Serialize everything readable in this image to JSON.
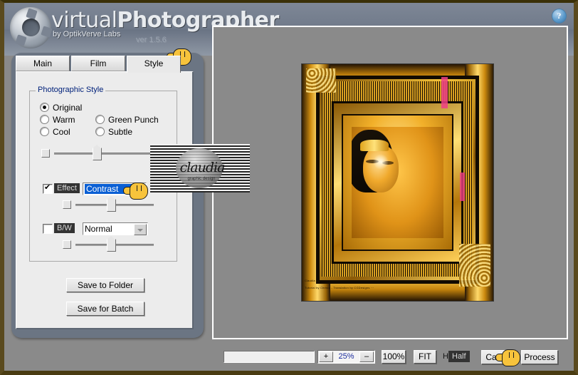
{
  "app": {
    "brand_prefix": "virtual",
    "brand_suffix": "Photographer",
    "brand_sub": "by OptikVerve Labs",
    "version": "ver 1.5.6",
    "help_icon": "question-mark-icon"
  },
  "tabs": [
    {
      "label": "Main",
      "active": false
    },
    {
      "label": "Film",
      "active": false
    },
    {
      "label": "Style",
      "active": true
    }
  ],
  "style_panel": {
    "group_title": "Photographic Style",
    "radios": [
      {
        "label": "Original",
        "selected": true
      },
      {
        "label": "Warm",
        "selected": false
      },
      {
        "label": "Green Punch",
        "selected": false
      },
      {
        "label": "Cool",
        "selected": false
      },
      {
        "label": "Subtle",
        "selected": false
      }
    ],
    "style_slider": {
      "name": "style-strength-slider",
      "value": 50
    },
    "effect": {
      "checkbox_label": "Effect",
      "checked": true,
      "selected_option": "Contrast",
      "slider_value": 50
    },
    "bw": {
      "checkbox_label": "B/W",
      "checked": false,
      "selected_option": "Normal",
      "slider_value": 50
    }
  },
  "actions": {
    "save_to_folder": "Save to Folder",
    "save_for_batch": "Save for Batch"
  },
  "toolbar": {
    "zoom_plus": "+",
    "zoom_value": "25%",
    "zoom_minus": "–",
    "zoom_100": "100%",
    "zoom_fit": "FIT",
    "half_prefix": "H",
    "half_label": "Half",
    "cancel": "Cancel",
    "process": "Process"
  },
  "preview": {
    "caption_line1": "Claudia  ···",
    "caption_line2": "Tutorial by Christa - Translation by CGDesigns ···"
  },
  "watermark": {
    "text": "claudia",
    "subtext": "graphic design"
  },
  "colors": {
    "accent_blue": "#0a5fd4",
    "group_title_blue": "#00217a",
    "zoom_value_blue": "#1d2e9e",
    "window_border": "#5a4a1e",
    "panel_bg": "#ececec",
    "plate_bg": "#6b7583",
    "preview_bg": "#8a8a8a",
    "dark_label_bg": "#333333",
    "gold": "#f0a71c"
  }
}
